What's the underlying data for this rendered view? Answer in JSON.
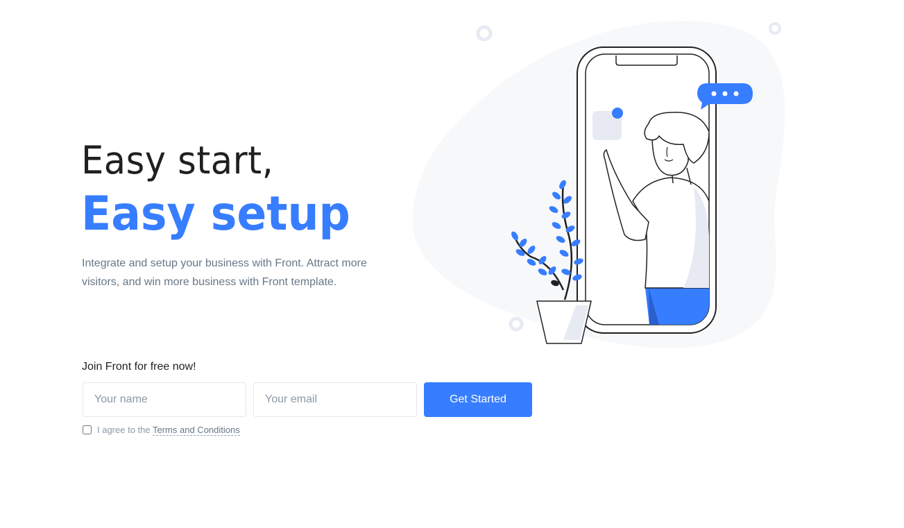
{
  "hero": {
    "title_line1": "Easy start,",
    "title_line2": "Easy setup",
    "description": "Integrate and setup your business with Front. Attract more visitors, and win more business with Front template."
  },
  "signup": {
    "join_label": "Join Front for free now!",
    "name_placeholder": "Your name",
    "email_placeholder": "Your email",
    "submit_label": "Get Started",
    "agree_prefix": "I agree to the ",
    "terms_link": "Terms and Conditions"
  },
  "colors": {
    "accent": "#377dff",
    "heading": "#1e2022",
    "body_text": "#677788",
    "blob": "#f7f8fa"
  },
  "icons": {
    "illustration": "person-in-phone-illustration",
    "chat": "chat-bubble-icon",
    "plant": "plant-icon"
  }
}
